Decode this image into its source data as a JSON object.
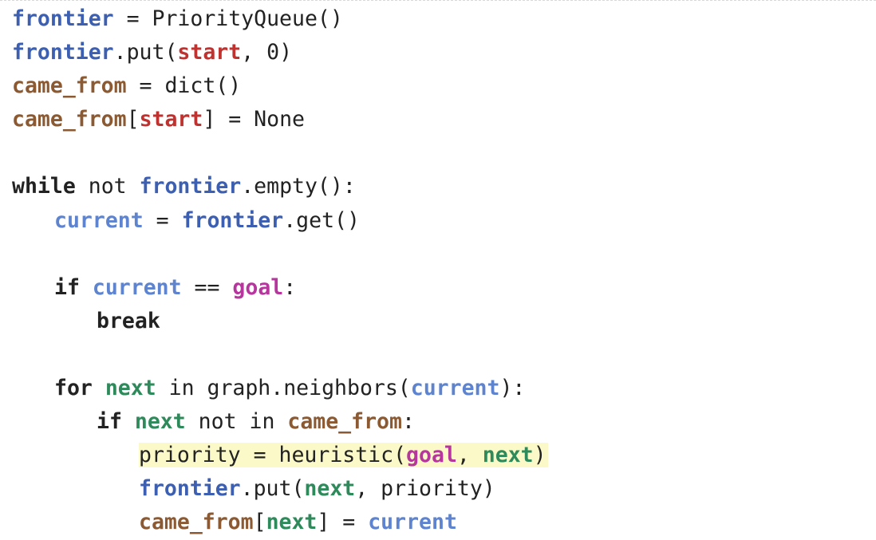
{
  "colors": {
    "frontier": "#3c5fb1",
    "current": "#5e84cf",
    "came_from": "#8b5a32",
    "start": "#c0322f",
    "goal": "#b6369e",
    "next": "#2e8a5a",
    "text": "#222222",
    "highlight": "#fbf9c8"
  },
  "lines": [
    {
      "indent": 0,
      "highlight": false,
      "tokens": [
        {
          "t": "frontier",
          "c": "frontier"
        },
        {
          "t": " = PriorityQueue()",
          "c": "plain"
        }
      ]
    },
    {
      "indent": 0,
      "highlight": false,
      "tokens": [
        {
          "t": "frontier",
          "c": "frontier"
        },
        {
          "t": ".put(",
          "c": "plain"
        },
        {
          "t": "start",
          "c": "start"
        },
        {
          "t": ", 0)",
          "c": "plain"
        }
      ]
    },
    {
      "indent": 0,
      "highlight": false,
      "tokens": [
        {
          "t": "came_from",
          "c": "came_from"
        },
        {
          "t": " = dict()",
          "c": "plain"
        }
      ]
    },
    {
      "indent": 0,
      "highlight": false,
      "tokens": [
        {
          "t": "came_from",
          "c": "came_from"
        },
        {
          "t": "[",
          "c": "plain"
        },
        {
          "t": "start",
          "c": "start"
        },
        {
          "t": "] = None",
          "c": "plain"
        }
      ]
    },
    {
      "indent": 0,
      "highlight": false,
      "tokens": []
    },
    {
      "indent": 0,
      "highlight": false,
      "tokens": [
        {
          "t": "while",
          "c": "kw"
        },
        {
          "t": " not ",
          "c": "plain"
        },
        {
          "t": "frontier",
          "c": "frontier"
        },
        {
          "t": ".empty():",
          "c": "plain"
        }
      ]
    },
    {
      "indent": 1,
      "highlight": false,
      "tokens": [
        {
          "t": "current",
          "c": "current"
        },
        {
          "t": " = ",
          "c": "plain"
        },
        {
          "t": "frontier",
          "c": "frontier"
        },
        {
          "t": ".get()",
          "c": "plain"
        }
      ]
    },
    {
      "indent": 0,
      "highlight": false,
      "tokens": []
    },
    {
      "indent": 1,
      "highlight": false,
      "tokens": [
        {
          "t": "if",
          "c": "kw"
        },
        {
          "t": " ",
          "c": "plain"
        },
        {
          "t": "current",
          "c": "current"
        },
        {
          "t": " == ",
          "c": "plain"
        },
        {
          "t": "goal",
          "c": "goal"
        },
        {
          "t": ":",
          "c": "plain"
        }
      ]
    },
    {
      "indent": 2,
      "highlight": false,
      "tokens": [
        {
          "t": "break",
          "c": "kw"
        }
      ]
    },
    {
      "indent": 0,
      "highlight": false,
      "tokens": []
    },
    {
      "indent": 1,
      "highlight": false,
      "tokens": [
        {
          "t": "for",
          "c": "kw"
        },
        {
          "t": " ",
          "c": "plain"
        },
        {
          "t": "next",
          "c": "next"
        },
        {
          "t": " in graph.neighbors(",
          "c": "plain"
        },
        {
          "t": "current",
          "c": "current"
        },
        {
          "t": "):",
          "c": "plain"
        }
      ]
    },
    {
      "indent": 2,
      "highlight": false,
      "tokens": [
        {
          "t": "if",
          "c": "kw"
        },
        {
          "t": " ",
          "c": "plain"
        },
        {
          "t": "next",
          "c": "next"
        },
        {
          "t": " not in ",
          "c": "plain"
        },
        {
          "t": "came_from",
          "c": "came_from"
        },
        {
          "t": ":",
          "c": "plain"
        }
      ]
    },
    {
      "indent": 3,
      "highlight": true,
      "tokens": [
        {
          "t": "priority = heuristic(",
          "c": "plain"
        },
        {
          "t": "goal",
          "c": "goal"
        },
        {
          "t": ", ",
          "c": "plain"
        },
        {
          "t": "next",
          "c": "next"
        },
        {
          "t": ")",
          "c": "plain"
        }
      ]
    },
    {
      "indent": 3,
      "highlight": false,
      "tokens": [
        {
          "t": "frontier",
          "c": "frontier"
        },
        {
          "t": ".put(",
          "c": "plain"
        },
        {
          "t": "next",
          "c": "next"
        },
        {
          "t": ", priority)",
          "c": "plain"
        }
      ]
    },
    {
      "indent": 3,
      "highlight": false,
      "tokens": [
        {
          "t": "came_from",
          "c": "came_from"
        },
        {
          "t": "[",
          "c": "plain"
        },
        {
          "t": "next",
          "c": "next"
        },
        {
          "t": "] = ",
          "c": "plain"
        },
        {
          "t": "current",
          "c": "current"
        }
      ]
    }
  ]
}
